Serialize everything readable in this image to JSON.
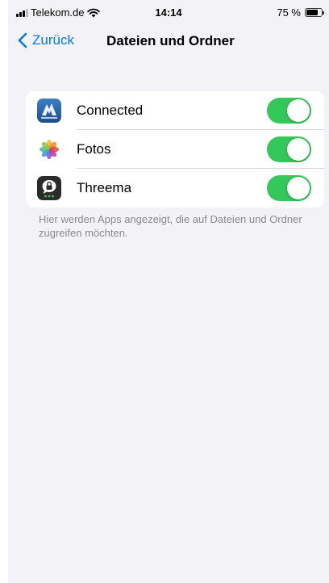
{
  "status_bar": {
    "carrier": "Telekom.de",
    "time": "14:14",
    "battery": "75 %",
    "battery_level": 0.75
  },
  "nav": {
    "back_label": "Zurück",
    "title": "Dateien und Ordner"
  },
  "apps": [
    {
      "name": "Connected",
      "icon": "connected-app-icon",
      "enabled": true
    },
    {
      "name": "Fotos",
      "icon": "photos-app-icon",
      "enabled": true
    },
    {
      "name": "Threema",
      "icon": "threema-app-icon",
      "enabled": true
    }
  ],
  "footer_text": "Hier werden Apps angezeigt, die auf Dateien und Ordner zugreifen möchten.",
  "colors": {
    "accent": "#007aff",
    "toggle_on": "#34c759",
    "background": "#f2f2f7"
  }
}
